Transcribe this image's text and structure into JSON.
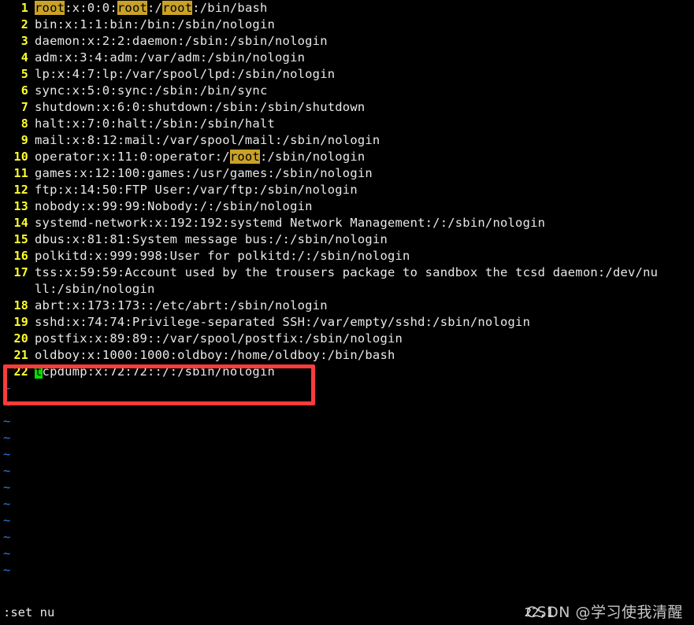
{
  "terminal": {
    "background_color": "#000000",
    "text_color": "#e8e8e8",
    "line_number_color": "#ffff2e",
    "tilde_color": "#2b7fe0",
    "search_highlight_bg": "#c9a227",
    "cursor_bg": "#00e000",
    "annotation_color": "#fa3c3c"
  },
  "lines": [
    {
      "num": "1",
      "segments": [
        {
          "t": "root",
          "s": "hl"
        },
        {
          "t": ":x:0:0:"
        },
        {
          "t": "root",
          "s": "hl"
        },
        {
          "t": ":/"
        },
        {
          "t": "root",
          "s": "hl"
        },
        {
          "t": ":/bin/bash"
        }
      ]
    },
    {
      "num": "2",
      "segments": [
        {
          "t": "bin:x:1:1:bin:/bin:/sbin/nologin"
        }
      ]
    },
    {
      "num": "3",
      "segments": [
        {
          "t": "daemon:x:2:2:daemon:/sbin:/sbin/nologin"
        }
      ]
    },
    {
      "num": "4",
      "segments": [
        {
          "t": "adm:x:3:4:adm:/var/adm:/sbin/nologin"
        }
      ]
    },
    {
      "num": "5",
      "segments": [
        {
          "t": "lp:x:4:7:lp:/var/spool/lpd:/sbin/nologin"
        }
      ]
    },
    {
      "num": "6",
      "segments": [
        {
          "t": "sync:x:5:0:sync:/sbin:/bin/sync"
        }
      ]
    },
    {
      "num": "7",
      "segments": [
        {
          "t": "shutdown:x:6:0:shutdown:/sbin:/sbin/shutdown"
        }
      ]
    },
    {
      "num": "8",
      "segments": [
        {
          "t": "halt:x:7:0:halt:/sbin:/sbin/halt"
        }
      ]
    },
    {
      "num": "9",
      "segments": [
        {
          "t": "mail:x:8:12:mail:/var/spool/mail:/sbin/nologin"
        }
      ]
    },
    {
      "num": "10",
      "segments": [
        {
          "t": "operator:x:11:0:operator:/"
        },
        {
          "t": "root",
          "s": "hl"
        },
        {
          "t": ":/sbin/nologin"
        }
      ]
    },
    {
      "num": "11",
      "segments": [
        {
          "t": "games:x:12:100:games:/usr/games:/sbin/nologin"
        }
      ]
    },
    {
      "num": "12",
      "segments": [
        {
          "t": "ftp:x:14:50:FTP User:/var/ftp:/sbin/nologin"
        }
      ]
    },
    {
      "num": "13",
      "segments": [
        {
          "t": "nobody:x:99:99:Nobody:/:/sbin/nologin"
        }
      ]
    },
    {
      "num": "14",
      "segments": [
        {
          "t": "systemd-network:x:192:192:systemd Network Management:/:/sbin/nologin"
        }
      ]
    },
    {
      "num": "15",
      "segments": [
        {
          "t": "dbus:x:81:81:System message bus:/:/sbin/nologin"
        }
      ]
    },
    {
      "num": "16",
      "segments": [
        {
          "t": "polkitd:x:999:998:User for polkitd:/:/sbin/nologin"
        }
      ]
    },
    {
      "num": "17",
      "segments": [
        {
          "t": "tss:x:59:59:Account used by the trousers package to sandbox the tcsd daemon:/dev/nu"
        }
      ]
    },
    {
      "num": "",
      "cont": true,
      "segments": [
        {
          "t": "ll:/sbin/nologin"
        }
      ]
    },
    {
      "num": "18",
      "segments": [
        {
          "t": "abrt:x:173:173::/etc/abrt:/sbin/nologin"
        }
      ]
    },
    {
      "num": "19",
      "segments": [
        {
          "t": "sshd:x:74:74:Privilege-separated SSH:/var/empty/sshd:/sbin/nologin"
        }
      ]
    },
    {
      "num": "20",
      "segments": [
        {
          "t": "postfix:x:89:89::/var/spool/postfix:/sbin/nologin"
        }
      ]
    },
    {
      "num": "21",
      "segments": [
        {
          "t": "oldboy:x:1000:1000:oldboy:/home/oldboy:/bin/bash"
        }
      ]
    },
    {
      "num": "22",
      "segments": [
        {
          "t": "t",
          "s": "cursor"
        },
        {
          "t": "cpdump:x:72:72::/:/sbin/nologin"
        }
      ]
    }
  ],
  "empty_marker": "~",
  "empty_line_count": 12,
  "status": {
    "command_line": ":set nu",
    "ruler": "22,1"
  },
  "watermark": {
    "text": "CSDN @学习使我清醒"
  }
}
